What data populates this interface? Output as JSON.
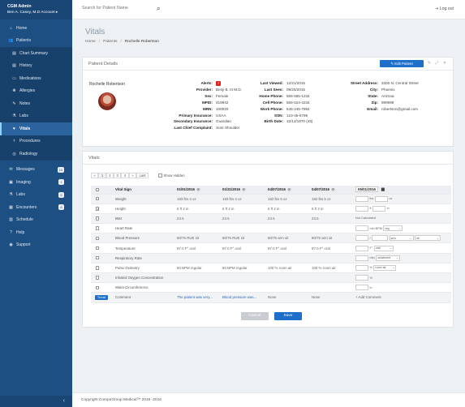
{
  "user": {
    "role": "CGM Admin",
    "name": "Ben A. Casey, M.D",
    "account": "Account ▸"
  },
  "sidebar": {
    "items": [
      {
        "label": "Home",
        "icon": "home-icon"
      },
      {
        "label": "Patients",
        "icon": "users-icon"
      }
    ],
    "sub_items": [
      {
        "label": "Chart Summary"
      },
      {
        "label": "History"
      },
      {
        "label": "Medications"
      },
      {
        "label": "Allergies"
      },
      {
        "label": "Notes"
      },
      {
        "label": "Labs"
      },
      {
        "label": "Vitals"
      },
      {
        "label": "Procedures"
      },
      {
        "label": "Radiology"
      }
    ],
    "bottom": [
      {
        "label": "Messages",
        "badge": "10"
      },
      {
        "label": "Imaging",
        "badge": "1"
      },
      {
        "label": "Labs",
        "badge": "5"
      },
      {
        "label": "Encounters",
        "badge": "8"
      },
      {
        "label": "Schedule",
        "badge": ""
      },
      {
        "label": "Help",
        "badge": ""
      },
      {
        "label": "Support",
        "badge": ""
      }
    ],
    "collapse": "‹"
  },
  "topbar": {
    "search_placeholder": "Search for Patient Name",
    "logout": "Log out"
  },
  "page": {
    "title": "Vitals",
    "breadcrumb": [
      "Home",
      "Patients",
      "Rochelle Robertson"
    ]
  },
  "patient_details": {
    "heading": "Patient Details",
    "edit_label": "✎ Edit Patient",
    "controls": "✎ ⤢ ✕",
    "name": "Rochelle Robertson",
    "col1": [
      {
        "k": "Alerts:",
        "v": "7"
      },
      {
        "k": "Provider:",
        "v": "Benji B. III M.D."
      },
      {
        "k": "Sex:",
        "v": "Female"
      },
      {
        "k": "MPID:",
        "v": "419942"
      },
      {
        "k": "MRN:",
        "v": "100020"
      },
      {
        "k": "Primary Insurance:",
        "v": "USAA"
      },
      {
        "k": "Secondary Insurance:",
        "v": "Guardian"
      },
      {
        "k": "Last Chief Complaint:",
        "v": "Sore Shoulder"
      }
    ],
    "col2": [
      {
        "k": "Last Viewed:",
        "v": "12/21/2015"
      },
      {
        "k": "Last Seen:",
        "v": "09/25/2015"
      },
      {
        "k": "Home Phone:",
        "v": "555-555-1234"
      },
      {
        "k": "Cell Phone:",
        "v": "555-524-4234"
      },
      {
        "k": "Work Phone:",
        "v": "545-245-7894"
      },
      {
        "k": "SSN:",
        "v": "123-45-6789"
      },
      {
        "k": "Birth Date:",
        "v": "12/12/1970 (45)"
      }
    ],
    "col3": [
      {
        "k": "Street Address:",
        "v": "3300 N. Central Street"
      },
      {
        "k": "City:",
        "v": "Phoenix"
      },
      {
        "k": "State:",
        "v": "Arizona"
      },
      {
        "k": "Zip:",
        "v": "999999"
      },
      {
        "k": "Email:",
        "v": "robertson@gmail.com"
      }
    ]
  },
  "vitals": {
    "heading": "Vitals",
    "pager": [
      "«",
      "1",
      "2",
      "3",
      "4",
      "»",
      "Last"
    ],
    "show_hidden": "Show Hidden",
    "header": {
      "name": "Vital Sign",
      "dates": [
        "01/01/2016",
        "01/31/2016",
        "04/07/2016",
        "04/07/2016"
      ],
      "input_date": "05/01/2016"
    },
    "rows": [
      {
        "name": "Weight",
        "checked": false,
        "vals": [
          "183 lbs 4 oz",
          "183 lbs 4 oz",
          "182 lbs 5 oz",
          "182 lbs 5 oz"
        ],
        "input": "lbs/oz"
      },
      {
        "name": "Height",
        "checked": true,
        "vals": [
          "6 ft 2 in",
          "6 ft 2 in",
          "6 ft 2 in",
          "6 ft 2 in"
        ],
        "input": "ftin"
      },
      {
        "name": "BMI",
        "checked": false,
        "vals": [
          "23.5",
          "23.5",
          "23.5",
          "23.5"
        ],
        "input": "text"
      },
      {
        "name": "Heart Rate",
        "checked": false,
        "vals": [
          "",
          "",
          "",
          ""
        ],
        "input": "hr"
      },
      {
        "name": "Blood Pressure",
        "checked": false,
        "vals": [
          "80/75 RUE sit",
          "80/75 RUE sit",
          "80/75 arm sit",
          "80/75 arm sit"
        ],
        "input": "bp"
      },
      {
        "name": "Temperature",
        "checked": false,
        "vals": [
          "97.0 F° oral",
          "97.0 F° oral",
          "97.0 F° oral",
          "97.0 F° oral"
        ],
        "input": "temp"
      },
      {
        "name": "Respiratory Rate",
        "checked": false,
        "vals": [
          "",
          "",
          "",
          ""
        ],
        "input": "resp"
      },
      {
        "name": "Pulse Oximetry",
        "checked": false,
        "vals": [
          "80 BPM regular",
          "80 BPM regular",
          "100 % room air",
          "100 % room air"
        ],
        "input": "pulse"
      },
      {
        "name": "Inhaled Oxygen Concentration",
        "checked": false,
        "vals": [
          "",
          "",
          "",
          ""
        ],
        "input": "o2"
      },
      {
        "name": "Waist Circumference",
        "checked": false,
        "vals": [
          "",
          "",
          "",
          ""
        ],
        "input": "waist"
      }
    ],
    "comment_row": {
      "trend": "Trend",
      "name": "Comment",
      "vals": [
        "The patient was very...",
        "Blood pressure was...",
        "None",
        "None"
      ],
      "add": "+ Add Comment"
    },
    "input_text": {
      "lbs": "lbs",
      "oz": "oz",
      "ft": "ft",
      "in": "in",
      "bmi": "Not Calculated",
      "hr_unit": "min BPM",
      "hr_sel": "reg",
      "bp_sep": "/",
      "bp_sel1": "arm",
      "bp_sel2": "sit",
      "temp_unit": "F°",
      "temp_sel": "oral",
      "resp_unit": "min",
      "resp_sel": "unlabored",
      "pulse_unit": "%",
      "pulse_sel": "room air",
      "o2_unit": "%",
      "waist_unit": "in"
    },
    "cancel": "Cancel",
    "save": "Save"
  },
  "footer": "Copyright CompuGroup Medical™ 2015 -2016"
}
